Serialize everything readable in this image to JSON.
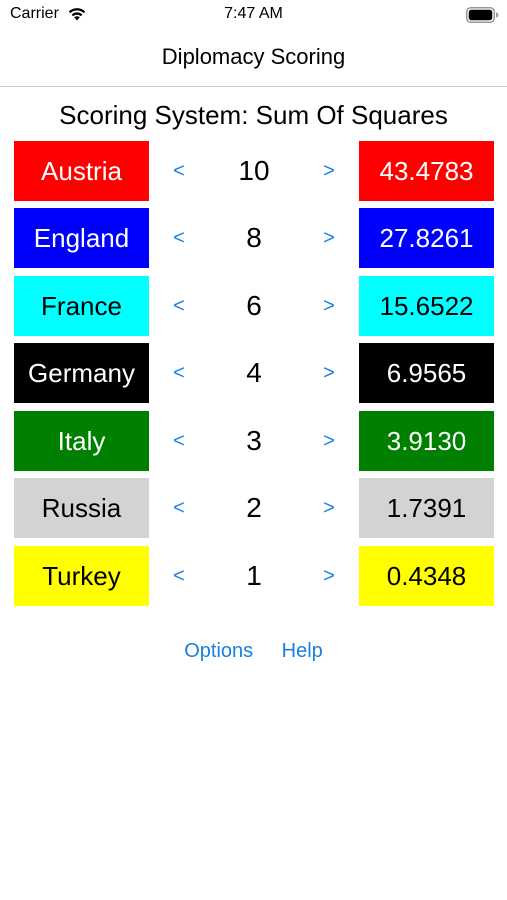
{
  "status_bar": {
    "carrier": "Carrier",
    "time": "7:47 AM"
  },
  "nav": {
    "title": "Diplomacy Scoring"
  },
  "scoring_system": "Scoring System: Sum Of Squares",
  "arrows": {
    "decrement": "<",
    "increment": ">"
  },
  "powers": [
    {
      "name": "Austria",
      "centers": "10",
      "score": "43.4783",
      "bg": "#ff0000",
      "fg": "#ffffff"
    },
    {
      "name": "England",
      "centers": "8",
      "score": "27.8261",
      "bg": "#0000ff",
      "fg": "#ffffff"
    },
    {
      "name": "France",
      "centers": "6",
      "score": "15.6522",
      "bg": "#00ffff",
      "fg": "#000000"
    },
    {
      "name": "Germany",
      "centers": "4",
      "score": "6.9565",
      "bg": "#000000",
      "fg": "#ffffff"
    },
    {
      "name": "Italy",
      "centers": "3",
      "score": "3.9130",
      "bg": "#008000",
      "fg": "#ffffff"
    },
    {
      "name": "Russia",
      "centers": "2",
      "score": "1.7391",
      "bg": "#d3d3d3",
      "fg": "#000000"
    },
    {
      "name": "Turkey",
      "centers": "1",
      "score": "0.4348",
      "bg": "#ffff00",
      "fg": "#000000"
    }
  ],
  "links": {
    "options": "Options",
    "help": "Help"
  },
  "colors": {
    "accent": "#1a7fe0"
  }
}
